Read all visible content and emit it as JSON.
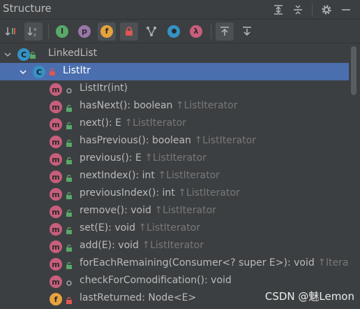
{
  "panel": {
    "title": "Structure"
  },
  "toolbar": {
    "buttons": [
      {
        "icon": "sort-by-visibility-icon"
      },
      {
        "icon": "sort-alphabetically-icon",
        "active": true
      },
      {
        "icon": "show-inherited-icon",
        "glyph": "I"
      },
      {
        "icon": "show-properties-icon",
        "glyph": "p"
      },
      {
        "icon": "show-fields-icon",
        "glyph": "f",
        "active": true
      },
      {
        "icon": "show-non-public-icon",
        "active": true
      },
      {
        "icon": "show-anonymous-classes-icon"
      },
      {
        "icon": "show-lambdas-icon"
      },
      {
        "icon": "show-lambdas-lambda-icon",
        "glyph": "λ"
      },
      {
        "icon": "autoscroll-to-source-icon",
        "active": true
      },
      {
        "icon": "autoscroll-from-source-icon"
      }
    ]
  },
  "tree": {
    "root": {
      "label": "LinkedList",
      "icon": "C"
    },
    "selected": {
      "label": "ListItr",
      "icon": "C"
    },
    "members": [
      {
        "icon": "m",
        "vis": "package",
        "name": "ListItr(int)",
        "type": "",
        "hint": ""
      },
      {
        "icon": "m",
        "vis": "public",
        "name": "hasNext(): boolean",
        "type": "",
        "hint": "↑ListIterator"
      },
      {
        "icon": "m",
        "vis": "public",
        "name": "next(): E",
        "type": "",
        "hint": "↑ListIterator"
      },
      {
        "icon": "m",
        "vis": "public",
        "name": "hasPrevious(): boolean",
        "type": "",
        "hint": "↑ListIterator"
      },
      {
        "icon": "m",
        "vis": "public",
        "name": "previous(): E",
        "type": "",
        "hint": "↑ListIterator"
      },
      {
        "icon": "m",
        "vis": "public",
        "name": "nextIndex(): int",
        "type": "",
        "hint": "↑ListIterator"
      },
      {
        "icon": "m",
        "vis": "public",
        "name": "previousIndex(): int",
        "type": "",
        "hint": "↑ListIterator"
      },
      {
        "icon": "m",
        "vis": "public",
        "name": "remove(): void",
        "type": "",
        "hint": "↑ListIterator"
      },
      {
        "icon": "m",
        "vis": "public",
        "name": "set(E): void",
        "type": "",
        "hint": "↑ListIterator"
      },
      {
        "icon": "m",
        "vis": "public",
        "name": "add(E): void",
        "type": "",
        "hint": "↑ListIterator"
      },
      {
        "icon": "m",
        "vis": "public",
        "name": "forEachRemaining(Consumer<? super E>): void",
        "type": "",
        "hint": "↑Iterato"
      },
      {
        "icon": "m",
        "vis": "package",
        "name": "checkForComodification(): void",
        "type": "",
        "hint": ""
      },
      {
        "icon": "f",
        "vis": "private",
        "name": "lastReturned: Node<E>",
        "type": "",
        "hint": ""
      }
    ]
  },
  "watermark": "CSDN @魅Lemon",
  "colors": {
    "selection": "#4b6eaf",
    "method": "#c85e7c",
    "class": "#3592c4",
    "field": "#e6a23c",
    "public": "#59a869",
    "private": "#e05555"
  }
}
